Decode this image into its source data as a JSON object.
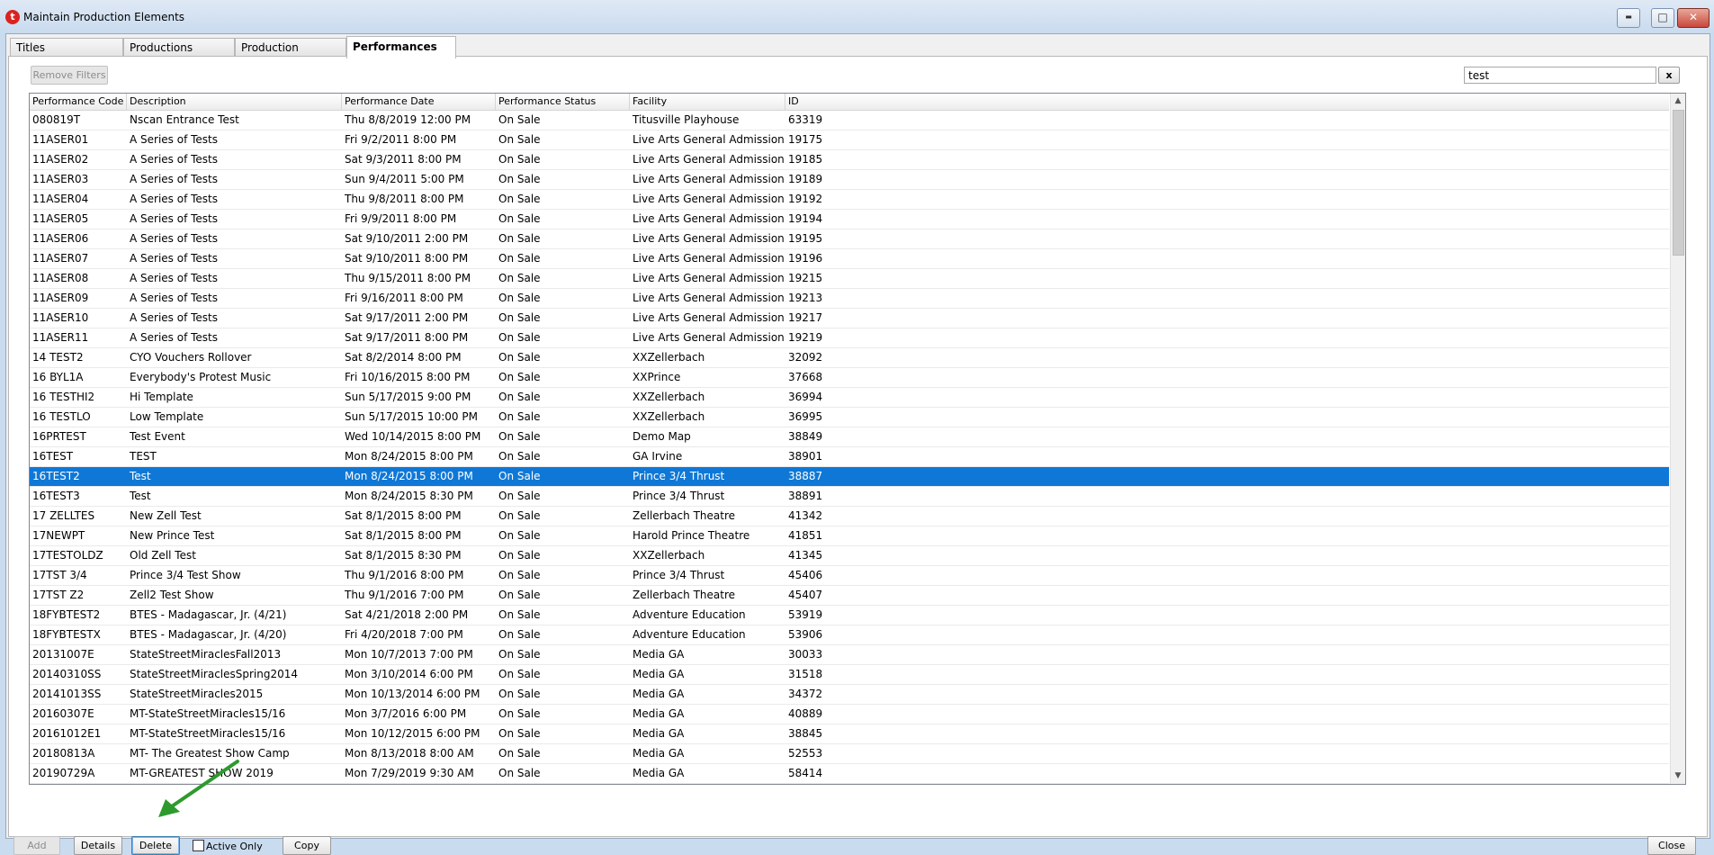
{
  "window": {
    "title": "Maintain Production Elements",
    "app_icon_letter": "t",
    "minimize_symbol": "▬",
    "maximize_symbol": "□",
    "close_symbol": "✕"
  },
  "tabs": [
    {
      "label": "Titles"
    },
    {
      "label": "Productions"
    },
    {
      "label": "Production Seasons"
    },
    {
      "label": "Performances"
    }
  ],
  "toolbar": {
    "remove_filters_label": "Remove Filters",
    "search_value": "test",
    "clear_label": "x"
  },
  "grid": {
    "columns": [
      "Performance Code",
      "Description",
      "Performance Date",
      "Performance Status",
      "Facility",
      "ID"
    ],
    "rows": [
      [
        "080819T",
        "Nscan Entrance Test",
        "Thu 8/8/2019 12:00 PM",
        "On Sale",
        "Titusville Playhouse",
        "63319"
      ],
      [
        "11ASER01",
        "A Series of Tests",
        "Fri 9/2/2011 8:00 PM",
        "On Sale",
        "Live Arts General Admission",
        "19175"
      ],
      [
        "11ASER02",
        "A Series of Tests",
        "Sat 9/3/2011 8:00 PM",
        "On Sale",
        "Live Arts General Admission",
        "19185"
      ],
      [
        "11ASER03",
        "A Series of Tests",
        "Sun 9/4/2011 5:00 PM",
        "On Sale",
        "Live Arts General Admission",
        "19189"
      ],
      [
        "11ASER04",
        "A Series of Tests",
        "Thu 9/8/2011 8:00 PM",
        "On Sale",
        "Live Arts General Admission",
        "19192"
      ],
      [
        "11ASER05",
        "A Series of Tests",
        "Fri 9/9/2011 8:00 PM",
        "On Sale",
        "Live Arts General Admission",
        "19194"
      ],
      [
        "11ASER06",
        "A Series of Tests",
        "Sat 9/10/2011 2:00 PM",
        "On Sale",
        "Live Arts General Admission",
        "19195"
      ],
      [
        "11ASER07",
        "A Series of Tests",
        "Sat 9/10/2011 8:00 PM",
        "On Sale",
        "Live Arts General Admission",
        "19196"
      ],
      [
        "11ASER08",
        "A Series of Tests",
        "Thu 9/15/2011 8:00 PM",
        "On Sale",
        "Live Arts General Admission",
        "19215"
      ],
      [
        "11ASER09",
        "A Series of Tests",
        "Fri 9/16/2011 8:00 PM",
        "On Sale",
        "Live Arts General Admission",
        "19213"
      ],
      [
        "11ASER10",
        "A Series of Tests",
        "Sat 9/17/2011 2:00 PM",
        "On Sale",
        "Live Arts General Admission",
        "19217"
      ],
      [
        "11ASER11",
        "A Series of Tests",
        "Sat 9/17/2011 8:00 PM",
        "On Sale",
        "Live Arts General Admission",
        "19219"
      ],
      [
        "14 TEST2",
        "CYO Vouchers Rollover",
        "Sat 8/2/2014 8:00 PM",
        "On Sale",
        "XXZellerbach",
        "32092"
      ],
      [
        "16 BYL1A",
        "Everybody's Protest Music",
        "Fri 10/16/2015 8:00 PM",
        "On Sale",
        "XXPrince",
        "37668"
      ],
      [
        "16 TESTHI2",
        "Hi Template",
        "Sun 5/17/2015 9:00 PM",
        "On Sale",
        "XXZellerbach",
        "36994"
      ],
      [
        "16 TESTLO",
        "Low Template",
        "Sun 5/17/2015 10:00 PM",
        "On Sale",
        "XXZellerbach",
        "36995"
      ],
      [
        "16PRTEST",
        "Test Event",
        "Wed 10/14/2015 8:00 PM",
        "On Sale",
        "Demo Map",
        "38849"
      ],
      [
        "16TEST",
        "TEST",
        "Mon 8/24/2015 8:00 PM",
        "On Sale",
        "GA Irvine",
        "38901"
      ],
      [
        "16TEST2",
        "Test",
        "Mon 8/24/2015 8:00 PM",
        "On Sale",
        "Prince 3/4 Thrust",
        "38887"
      ],
      [
        "16TEST3",
        "Test",
        "Mon 8/24/2015 8:30 PM",
        "On Sale",
        "Prince 3/4 Thrust",
        "38891"
      ],
      [
        "17 ZELLTES",
        "New Zell Test",
        "Sat 8/1/2015 8:00 PM",
        "On Sale",
        "Zellerbach Theatre",
        "41342"
      ],
      [
        "17NEWPT",
        "New Prince Test",
        "Sat 8/1/2015 8:00 PM",
        "On Sale",
        "Harold Prince Theatre",
        "41851"
      ],
      [
        "17TESTOLDZ",
        "Old Zell Test",
        "Sat 8/1/2015 8:30 PM",
        "On Sale",
        "XXZellerbach",
        "41345"
      ],
      [
        "17TST 3/4",
        "Prince 3/4 Test Show",
        "Thu 9/1/2016 8:00 PM",
        "On Sale",
        "Prince 3/4 Thrust",
        "45406"
      ],
      [
        "17TST Z2",
        "Zell2 Test Show",
        "Thu 9/1/2016 7:00 PM",
        "On Sale",
        "Zellerbach Theatre",
        "45407"
      ],
      [
        "18FYBTEST2",
        "BTES - Madagascar, Jr. (4/21)",
        "Sat 4/21/2018 2:00 PM",
        "On Sale",
        "Adventure Education",
        "53919"
      ],
      [
        "18FYBTESTX",
        "BTES - Madagascar, Jr. (4/20)",
        "Fri 4/20/2018 7:00 PM",
        "On Sale",
        "Adventure Education",
        "53906"
      ],
      [
        "20131007E",
        "StateStreetMiraclesFall2013",
        "Mon 10/7/2013 7:00 PM",
        "On Sale",
        "Media GA",
        "30033"
      ],
      [
        "20140310SS",
        "StateStreetMiraclesSpring2014",
        "Mon 3/10/2014 6:00 PM",
        "On Sale",
        "Media GA",
        "31518"
      ],
      [
        "20141013SS",
        "StateStreetMiracles2015",
        "Mon 10/13/2014 6:00 PM",
        "On Sale",
        "Media GA",
        "34372"
      ],
      [
        "20160307E",
        "MT-StateStreetMiracles15/16",
        "Mon 3/7/2016 6:00 PM",
        "On Sale",
        "Media GA",
        "40889"
      ],
      [
        "20161012E1",
        "MT-StateStreetMiracles15/16",
        "Mon 10/12/2015 6:00 PM",
        "On Sale",
        "Media GA",
        "38845"
      ],
      [
        "20180813A",
        "MT- The Greatest Show Camp",
        "Mon 8/13/2018 8:00 AM",
        "On Sale",
        "Media GA",
        "52553"
      ],
      [
        "20190729A",
        "MT-GREATEST SHOW 2019",
        "Mon 7/29/2019 9:30 AM",
        "On Sale",
        "Media GA",
        "58414"
      ]
    ],
    "selected_row_index": 18
  },
  "footer": {
    "add_label": "Add",
    "details_label": "Details",
    "delete_label": "Delete",
    "active_only_label": "Active Only",
    "copy_label": "Copy",
    "close_label": "Close"
  },
  "colors": {
    "selection": "#0f78d7",
    "annotation_arrow": "#2e9a2e"
  }
}
